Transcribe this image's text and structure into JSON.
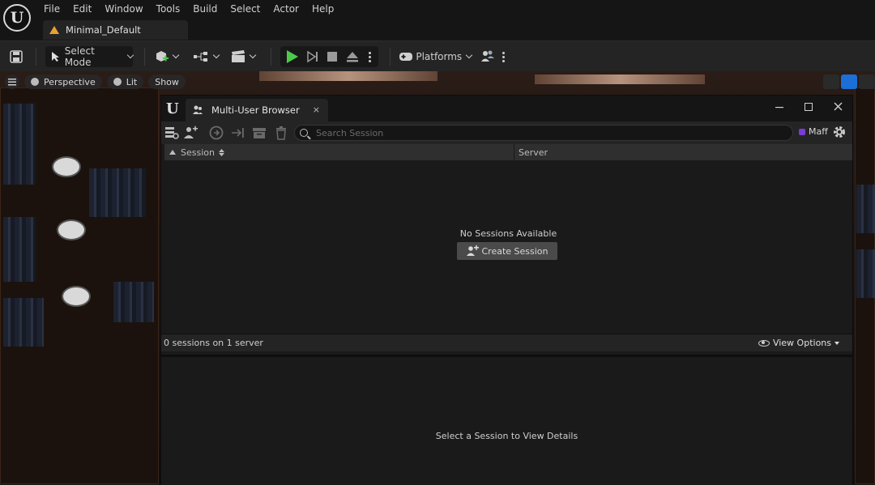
{
  "menu": {
    "logo": "U",
    "items": [
      "File",
      "Edit",
      "Window",
      "Tools",
      "Build",
      "Select",
      "Actor",
      "Help"
    ]
  },
  "level_tab": {
    "label": "Minimal_Default"
  },
  "toolbar": {
    "select_mode": "Select Mode",
    "platforms": "Platforms"
  },
  "viewport": {
    "perspective": "Perspective",
    "lit": "Lit",
    "show": "Show"
  },
  "browser": {
    "logo": "U",
    "tab_title": "Multi-User Browser",
    "tab_close": "×",
    "search_placeholder": "Search Session",
    "user_name": "Maff",
    "columns": {
      "session": "Session",
      "server": "Server"
    },
    "empty_message": "No Sessions Available",
    "create_session": "Create Session",
    "status": "0 sessions on 1 server",
    "view_options": "View Options",
    "details_message": "Select a Session to View Details"
  },
  "colors": {
    "play_green": "#4cc94c",
    "accent_blue": "#1b6fd6",
    "user_purple": "#7a3bd6",
    "warning_orange": "#e8a030"
  }
}
